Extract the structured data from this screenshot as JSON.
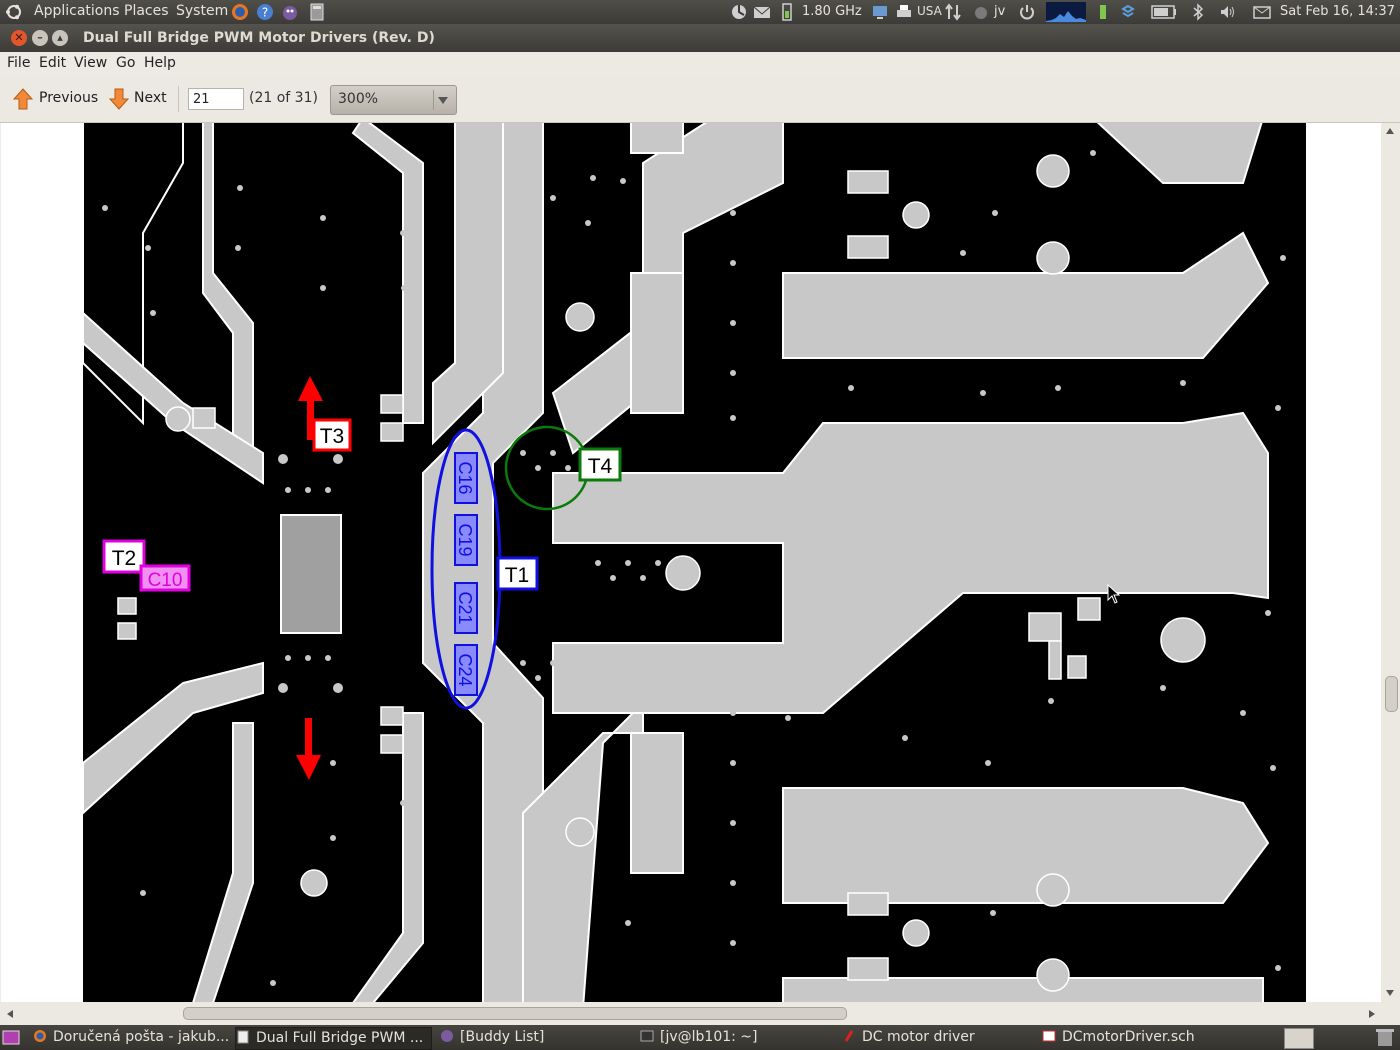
{
  "top_panel": {
    "menus": [
      "Applications",
      "Places",
      "System"
    ],
    "cpu_freq": "1.80 GHz",
    "keyboard_layout": "USA",
    "user": "jv",
    "clock": "Sat Feb 16, 14:37"
  },
  "window": {
    "title": "Dual Full Bridge PWM Motor Drivers (Rev. D)",
    "menu": [
      "File",
      "Edit",
      "View",
      "Go",
      "Help"
    ]
  },
  "toolbar": {
    "previous_label": "Previous",
    "next_label": "Next",
    "page_value": "21",
    "page_count": "(21 of 31)",
    "zoom": "300%"
  },
  "annotations": {
    "labels": [
      "T3",
      "T4",
      "T1",
      "T2",
      "C10"
    ],
    "capacitors": [
      "C16",
      "C19",
      "C21",
      "C24"
    ],
    "colors": {
      "red": "#ff0000",
      "green": "#0a7a0a",
      "blue": "#1010e0",
      "magenta": "#e000e0"
    }
  },
  "taskbar": {
    "items": [
      "Doručená pošta - jakub...",
      "Dual Full Bridge PWM ...",
      "[Buddy List]",
      "[jv@lb101: ~]",
      "DC motor driver",
      "DCmotorDriver.sch"
    ],
    "active_index": 1
  },
  "icons": [
    "ubuntu-logo-icon",
    "firefox-icon",
    "help-icon",
    "pidgin-icon",
    "calculator-icon",
    "weather-icon",
    "mail-icon",
    "network-icon",
    "printer-icon",
    "transfer-icon",
    "power-icon",
    "sysmonitor-icon",
    "battery-icon",
    "bluetooth-icon",
    "volume-icon",
    "envelope-icon",
    "arrow-up-icon",
    "arrow-down-icon",
    "chevron-down-icon"
  ]
}
